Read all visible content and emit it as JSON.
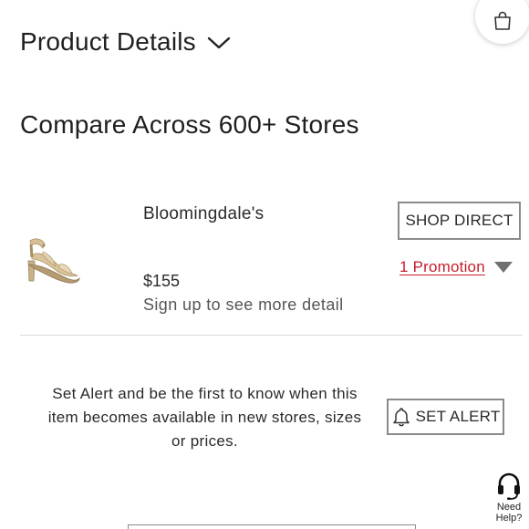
{
  "header": {
    "product_details_label": "Product Details",
    "bag_icon": "shopping-bag-icon",
    "chevron_icon": "chevron-down-icon"
  },
  "compare": {
    "title": "Compare Across 600+ Stores"
  },
  "offer": {
    "store_name": "Bloomingdale's",
    "price": "$155",
    "signup_text": "Sign up to see more detail",
    "shop_button_label": "SHOP DIRECT",
    "promotion_label": "1 Promotion",
    "promotion_color": "#c41f2d",
    "image_icon": "sandal-product-image"
  },
  "alert": {
    "text": "Set Alert and be the first to know when this item becomes available in new stores, sizes or prices.",
    "button_label": "SET ALERT",
    "bell_icon": "bell-icon"
  },
  "help": {
    "label_line1": "Need",
    "label_line2": "Help?",
    "icon": "headset-icon"
  }
}
